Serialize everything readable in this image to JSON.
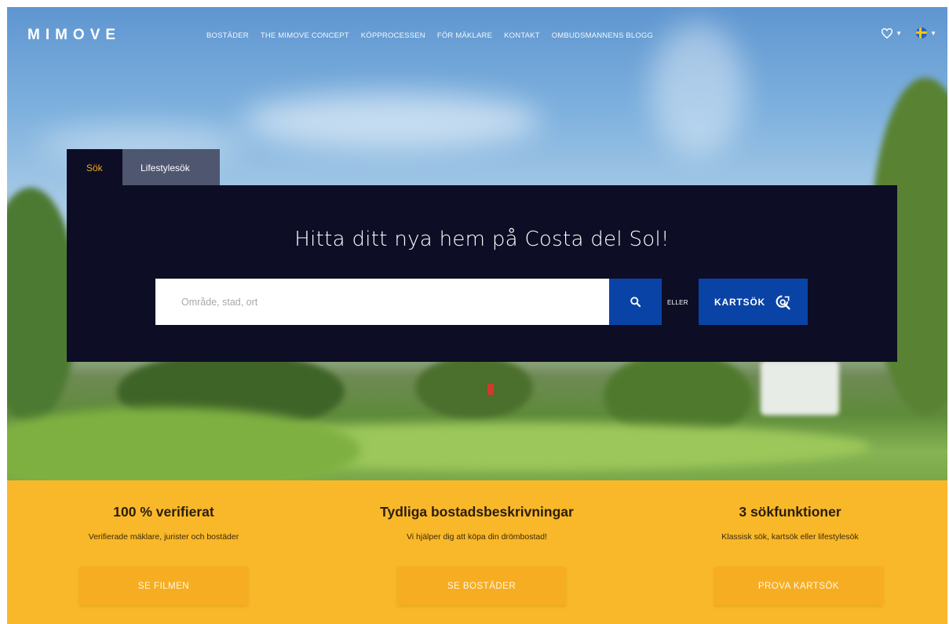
{
  "nav": {
    "logo": "MIMOVE",
    "links": [
      "BOSTÄDER",
      "THE MIMOVE CONCEPT",
      "KÖPPROCESSEN",
      "FÖR MÄKLARE",
      "KONTAKT",
      "OMBUDSMANNENS BLOGG"
    ],
    "favorites_icon": "heart-icon",
    "language_icon": "swedish-flag-icon"
  },
  "search": {
    "tabs": [
      "Sök",
      "Lifestylesök"
    ],
    "heading": "Hitta ditt nya hem på Costa del Sol!",
    "placeholder": "Område, stad, ort",
    "search_icon": "search-icon",
    "or_label": "ELLER",
    "map_button_label": "KARTSÖK",
    "map_icon": "map-search-icon"
  },
  "features": [
    {
      "title": "100 % verifierat",
      "subtitle": "Verifierade mäklare, jurister och bostäder",
      "button": "SE FILMEN"
    },
    {
      "title": "Tydliga bostadsbeskrivningar",
      "subtitle": "Vi hjälper dig att köpa din drömbostad!",
      "button": "SE BOSTÄDER"
    },
    {
      "title": "3 sökfunktioner",
      "subtitle": "Klassisk sök, kartsök eller lifestylesök",
      "button": "PROVA KARTSÖK"
    }
  ],
  "colors": {
    "panel": "#0d0e25",
    "accent_blue": "#0a43a6",
    "accent_yellow": "#f9b82a",
    "tab_active_text": "#f2a923"
  }
}
